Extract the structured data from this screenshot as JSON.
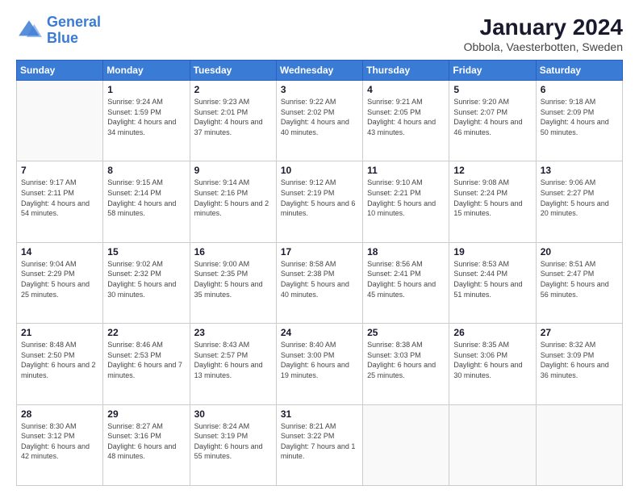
{
  "logo": {
    "text_general": "General",
    "text_blue": "Blue"
  },
  "header": {
    "title": "January 2024",
    "subtitle": "Obbola, Vaesterbotten, Sweden"
  },
  "weekdays": [
    "Sunday",
    "Monday",
    "Tuesday",
    "Wednesday",
    "Thursday",
    "Friday",
    "Saturday"
  ],
  "weeks": [
    [
      {
        "day": "",
        "sunrise": "",
        "sunset": "",
        "daylight": "",
        "empty": true
      },
      {
        "day": "1",
        "sunrise": "Sunrise: 9:24 AM",
        "sunset": "Sunset: 1:59 PM",
        "daylight": "Daylight: 4 hours and 34 minutes."
      },
      {
        "day": "2",
        "sunrise": "Sunrise: 9:23 AM",
        "sunset": "Sunset: 2:01 PM",
        "daylight": "Daylight: 4 hours and 37 minutes."
      },
      {
        "day": "3",
        "sunrise": "Sunrise: 9:22 AM",
        "sunset": "Sunset: 2:02 PM",
        "daylight": "Daylight: 4 hours and 40 minutes."
      },
      {
        "day": "4",
        "sunrise": "Sunrise: 9:21 AM",
        "sunset": "Sunset: 2:05 PM",
        "daylight": "Daylight: 4 hours and 43 minutes."
      },
      {
        "day": "5",
        "sunrise": "Sunrise: 9:20 AM",
        "sunset": "Sunset: 2:07 PM",
        "daylight": "Daylight: 4 hours and 46 minutes."
      },
      {
        "day": "6",
        "sunrise": "Sunrise: 9:18 AM",
        "sunset": "Sunset: 2:09 PM",
        "daylight": "Daylight: 4 hours and 50 minutes."
      }
    ],
    [
      {
        "day": "7",
        "sunrise": "Sunrise: 9:17 AM",
        "sunset": "Sunset: 2:11 PM",
        "daylight": "Daylight: 4 hours and 54 minutes."
      },
      {
        "day": "8",
        "sunrise": "Sunrise: 9:15 AM",
        "sunset": "Sunset: 2:14 PM",
        "daylight": "Daylight: 4 hours and 58 minutes."
      },
      {
        "day": "9",
        "sunrise": "Sunrise: 9:14 AM",
        "sunset": "Sunset: 2:16 PM",
        "daylight": "Daylight: 5 hours and 2 minutes."
      },
      {
        "day": "10",
        "sunrise": "Sunrise: 9:12 AM",
        "sunset": "Sunset: 2:19 PM",
        "daylight": "Daylight: 5 hours and 6 minutes."
      },
      {
        "day": "11",
        "sunrise": "Sunrise: 9:10 AM",
        "sunset": "Sunset: 2:21 PM",
        "daylight": "Daylight: 5 hours and 10 minutes."
      },
      {
        "day": "12",
        "sunrise": "Sunrise: 9:08 AM",
        "sunset": "Sunset: 2:24 PM",
        "daylight": "Daylight: 5 hours and 15 minutes."
      },
      {
        "day": "13",
        "sunrise": "Sunrise: 9:06 AM",
        "sunset": "Sunset: 2:27 PM",
        "daylight": "Daylight: 5 hours and 20 minutes."
      }
    ],
    [
      {
        "day": "14",
        "sunrise": "Sunrise: 9:04 AM",
        "sunset": "Sunset: 2:29 PM",
        "daylight": "Daylight: 5 hours and 25 minutes."
      },
      {
        "day": "15",
        "sunrise": "Sunrise: 9:02 AM",
        "sunset": "Sunset: 2:32 PM",
        "daylight": "Daylight: 5 hours and 30 minutes."
      },
      {
        "day": "16",
        "sunrise": "Sunrise: 9:00 AM",
        "sunset": "Sunset: 2:35 PM",
        "daylight": "Daylight: 5 hours and 35 minutes."
      },
      {
        "day": "17",
        "sunrise": "Sunrise: 8:58 AM",
        "sunset": "Sunset: 2:38 PM",
        "daylight": "Daylight: 5 hours and 40 minutes."
      },
      {
        "day": "18",
        "sunrise": "Sunrise: 8:56 AM",
        "sunset": "Sunset: 2:41 PM",
        "daylight": "Daylight: 5 hours and 45 minutes."
      },
      {
        "day": "19",
        "sunrise": "Sunrise: 8:53 AM",
        "sunset": "Sunset: 2:44 PM",
        "daylight": "Daylight: 5 hours and 51 minutes."
      },
      {
        "day": "20",
        "sunrise": "Sunrise: 8:51 AM",
        "sunset": "Sunset: 2:47 PM",
        "daylight": "Daylight: 5 hours and 56 minutes."
      }
    ],
    [
      {
        "day": "21",
        "sunrise": "Sunrise: 8:48 AM",
        "sunset": "Sunset: 2:50 PM",
        "daylight": "Daylight: 6 hours and 2 minutes."
      },
      {
        "day": "22",
        "sunrise": "Sunrise: 8:46 AM",
        "sunset": "Sunset: 2:53 PM",
        "daylight": "Daylight: 6 hours and 7 minutes."
      },
      {
        "day": "23",
        "sunrise": "Sunrise: 8:43 AM",
        "sunset": "Sunset: 2:57 PM",
        "daylight": "Daylight: 6 hours and 13 minutes."
      },
      {
        "day": "24",
        "sunrise": "Sunrise: 8:40 AM",
        "sunset": "Sunset: 3:00 PM",
        "daylight": "Daylight: 6 hours and 19 minutes."
      },
      {
        "day": "25",
        "sunrise": "Sunrise: 8:38 AM",
        "sunset": "Sunset: 3:03 PM",
        "daylight": "Daylight: 6 hours and 25 minutes."
      },
      {
        "day": "26",
        "sunrise": "Sunrise: 8:35 AM",
        "sunset": "Sunset: 3:06 PM",
        "daylight": "Daylight: 6 hours and 30 minutes."
      },
      {
        "day": "27",
        "sunrise": "Sunrise: 8:32 AM",
        "sunset": "Sunset: 3:09 PM",
        "daylight": "Daylight: 6 hours and 36 minutes."
      }
    ],
    [
      {
        "day": "28",
        "sunrise": "Sunrise: 8:30 AM",
        "sunset": "Sunset: 3:12 PM",
        "daylight": "Daylight: 6 hours and 42 minutes."
      },
      {
        "day": "29",
        "sunrise": "Sunrise: 8:27 AM",
        "sunset": "Sunset: 3:16 PM",
        "daylight": "Daylight: 6 hours and 48 minutes."
      },
      {
        "day": "30",
        "sunrise": "Sunrise: 8:24 AM",
        "sunset": "Sunset: 3:19 PM",
        "daylight": "Daylight: 6 hours and 55 minutes."
      },
      {
        "day": "31",
        "sunrise": "Sunrise: 8:21 AM",
        "sunset": "Sunset: 3:22 PM",
        "daylight": "Daylight: 7 hours and 1 minute."
      },
      {
        "day": "",
        "sunrise": "",
        "sunset": "",
        "daylight": "",
        "empty": true
      },
      {
        "day": "",
        "sunrise": "",
        "sunset": "",
        "daylight": "",
        "empty": true
      },
      {
        "day": "",
        "sunrise": "",
        "sunset": "",
        "daylight": "",
        "empty": true
      }
    ]
  ]
}
